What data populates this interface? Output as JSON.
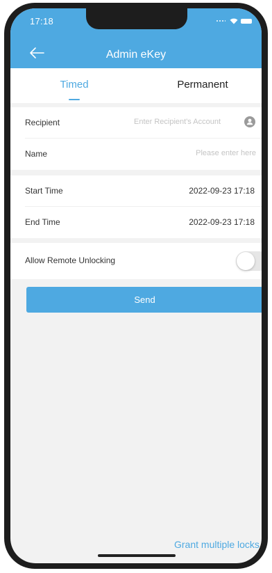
{
  "status": {
    "time": "17:18"
  },
  "header": {
    "title": "Admin eKey"
  },
  "tabs": [
    {
      "label": "Timed",
      "active": true
    },
    {
      "label": "Permanent",
      "active": false
    }
  ],
  "form": {
    "recipient": {
      "label": "Recipient",
      "placeholder": "Enter Recipient's Account"
    },
    "name": {
      "label": "Name",
      "placeholder": "Please enter here"
    },
    "start_time": {
      "label": "Start Time",
      "value": "2022-09-23 17:18"
    },
    "end_time": {
      "label": "End Time",
      "value": "2022-09-23 17:18"
    },
    "remote_unlock": {
      "label": "Allow Remote Unlocking",
      "enabled": false
    }
  },
  "actions": {
    "send_label": "Send",
    "grant_label": "Grant multiple locks"
  },
  "icons": {
    "back": "arrow-left-icon",
    "contact": "contact-person-icon",
    "wifi": "wifi-icon",
    "battery": "battery-icon"
  },
  "colors": {
    "accent": "#4ea9e1",
    "background": "#f2f2f2",
    "toggle_off": "#e6e6e6"
  }
}
